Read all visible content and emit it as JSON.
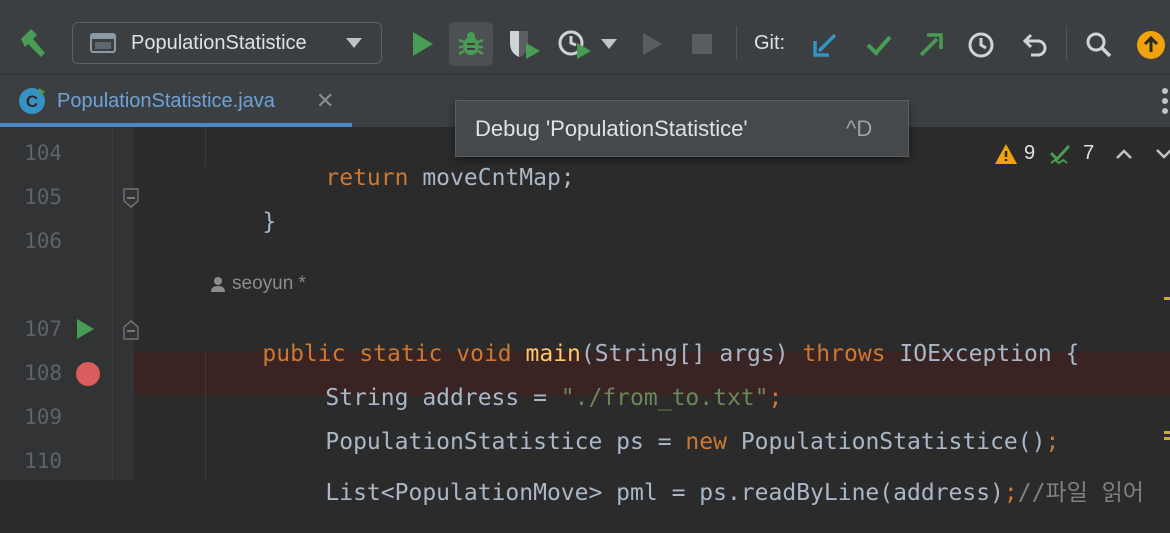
{
  "toolbar": {
    "run_config": {
      "label": "PopulationStatistice",
      "icon": "application-config-icon"
    },
    "buttons": [
      "build-hammer-icon",
      "run-icon",
      "debug-icon",
      "coverage-icon",
      "profile-icon",
      "stop-icon"
    ],
    "git_label": "Git:",
    "git_buttons": [
      "git-update-icon",
      "git-commit-icon",
      "git-push-icon",
      "git-history-icon",
      "git-rollback-icon"
    ],
    "colors": {
      "run": "#499c54",
      "git_blue": "#3592c4",
      "update_badge": "#f0a30a"
    }
  },
  "tab": {
    "label": "PopulationStatistice.java",
    "close": "✕"
  },
  "tooltip": {
    "text": "Debug 'PopulationStatistice'",
    "shortcut": "^D"
  },
  "inspections": {
    "warnings": "9",
    "typos": "7"
  },
  "editor": {
    "author": "seoyun *",
    "lines": [
      {
        "no": "104"
      },
      {
        "no": "105"
      },
      {
        "no": "106"
      },
      {
        "no": "107"
      },
      {
        "no": "108"
      },
      {
        "no": "109"
      },
      {
        "no": "110"
      }
    ],
    "code": {
      "l104_kw": "return",
      "l104_rest": " moveCntMap;",
      "l105": "}",
      "l107_mods": "public static void ",
      "l107_fn": "main",
      "l107_params": "(String[] args) ",
      "l107_throws": "throws",
      "l107_rest": " IOException {",
      "l108_a": "String address = ",
      "l108_str": "\"./from_to.txt\"",
      "l108_semi": ";",
      "l109_a": "PopulationStatistice ps = ",
      "l109_new": "new",
      "l109_b": " PopulationStatistice()",
      "l109_semi": ";",
      "l110_a": "List<PopulationMove> pml = ps.readByLine(address)",
      "l110_semi": ";",
      "l110_cmt": "//파일 읽어"
    }
  }
}
